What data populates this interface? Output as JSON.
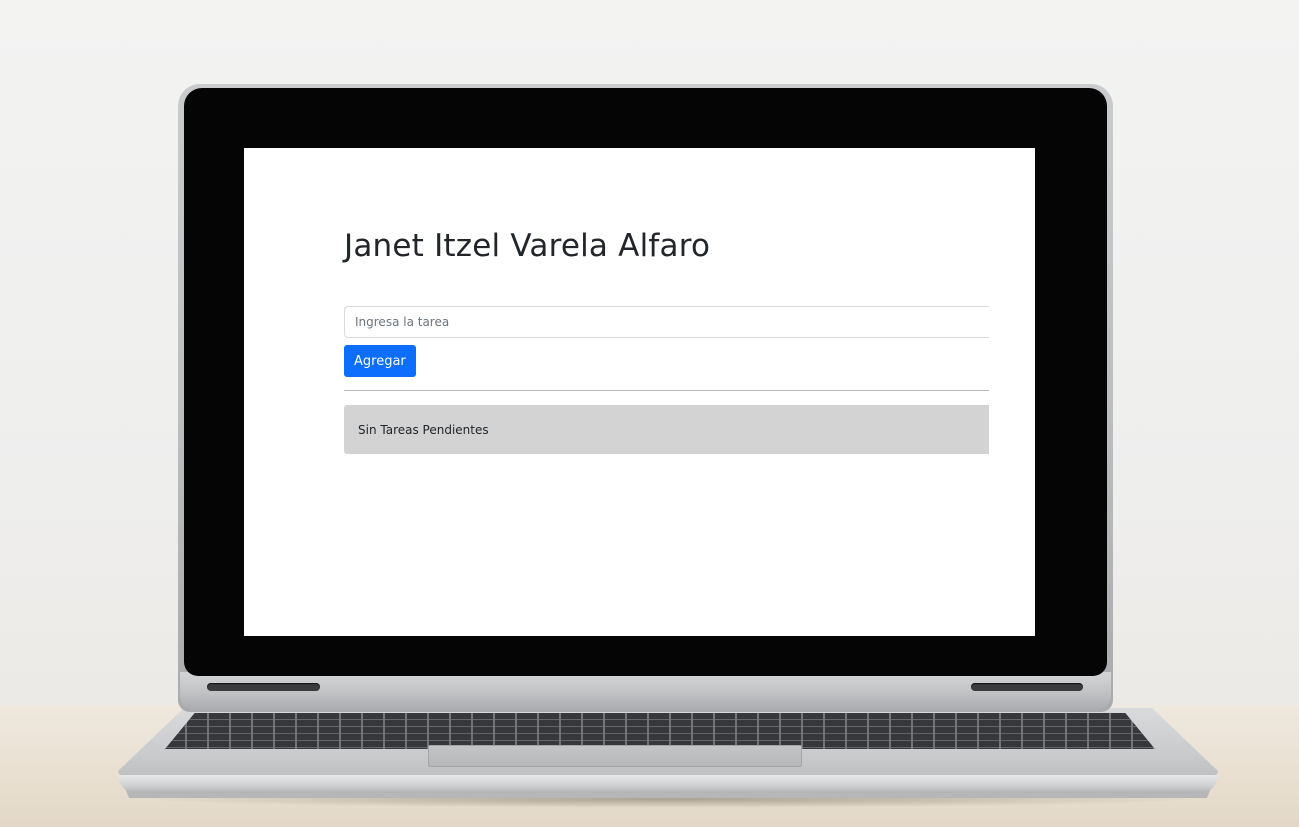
{
  "app": {
    "title": "Janet Itzel Varela Alfaro",
    "task_input": {
      "value": "",
      "placeholder": "Ingresa la tarea"
    },
    "add_button_label": "Agregar",
    "empty_message": "Sin Tareas Pendientes"
  },
  "colors": {
    "primary_button": "#0d6efd",
    "empty_box_background": "#d3d3d3",
    "title_text": "#222529"
  }
}
